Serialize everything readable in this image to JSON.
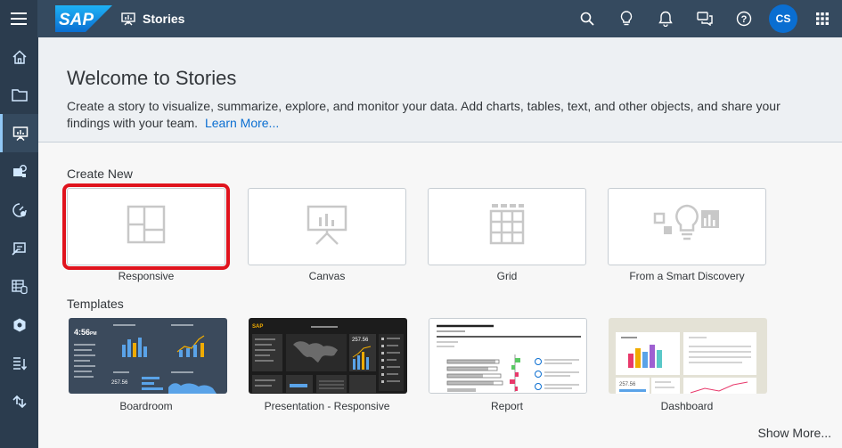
{
  "shell": {
    "logo_text": "SAP",
    "app_title": "Stories",
    "avatar_initials": "CS",
    "actions": [
      "search-icon",
      "lightbulb-icon",
      "notification-icon",
      "chat-icon",
      "help-icon"
    ],
    "logo_color": "#0a6ed1",
    "bar_color": "#354a5f"
  },
  "leftnav": {
    "items": [
      "home-icon",
      "folder-icon",
      "stories-icon",
      "analytics-designer-icon",
      "explore-icon",
      "planning-icon",
      "datasets-icon",
      "models-icon",
      "data-import-icon",
      "connections-icon"
    ],
    "active_index": 2
  },
  "welcome": {
    "title": "Welcome to Stories",
    "description": "Create a story to visualize, summarize, explore, and monitor your data. Add charts, tables, text, and other objects, and share your findings with your team.",
    "link": "Learn More..."
  },
  "create_new": {
    "heading": "Create New",
    "tiles": [
      {
        "label": "Responsive",
        "icon": "responsive-layout-icon"
      },
      {
        "label": "Canvas",
        "icon": "presentation-canvas-icon"
      },
      {
        "label": "Grid",
        "icon": "grid-table-icon"
      },
      {
        "label": "From a Smart Discovery",
        "icon": "smart-discovery-icon"
      }
    ]
  },
  "templates": {
    "heading": "Templates",
    "items": [
      {
        "label": "Boardroom",
        "time": "4:56",
        "time_suffix": "PM",
        "value": "257.56"
      },
      {
        "label": "Presentation - Responsive",
        "brand": "SAP",
        "value": "257.56"
      },
      {
        "label": "Report"
      },
      {
        "label": "Dashboard",
        "value": "257.56"
      }
    ]
  },
  "show_more": "Show More..."
}
